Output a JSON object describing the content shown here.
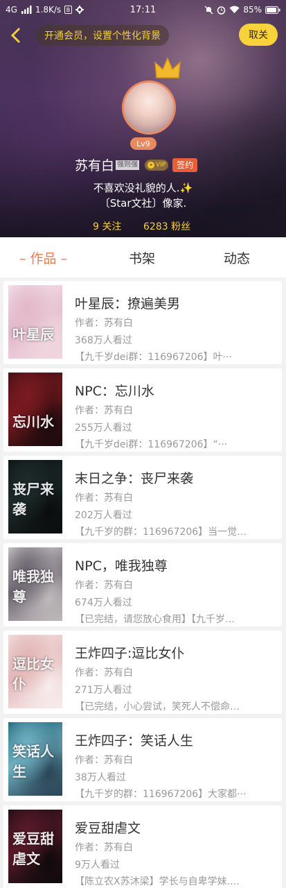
{
  "status_bar": {
    "network": "4G",
    "speed": "1.8K/s",
    "time": "17:11",
    "battery": "85%"
  },
  "header": {
    "banner_text": "开通会员，设置个性化背景",
    "cancel_label": "取关",
    "level": "Lv9",
    "username": "苏有白",
    "name_tag": "强则强",
    "vip_label": "VIP",
    "sign_label": "签约",
    "bio_line1": "不喜欢没礼貌的人.",
    "bio_sparkle": "✨",
    "bio_line2": "〔Star文社〕像家.",
    "follow_count": "9 关注",
    "fans_count": "6283 粉丝"
  },
  "tabs": {
    "works": "– 作品 –",
    "shelf": "书架",
    "feed": "动态"
  },
  "books": [
    {
      "title": "叶星辰：撩遍美男",
      "author": "作者：苏有白",
      "views": "368万人看过",
      "desc": "【九千岁dei群：116967206】叶···",
      "cover_text": "叶星辰",
      "cover_colors": [
        "#f6e7ee",
        "#e2b8c9",
        "#f0d6df"
      ]
    },
    {
      "title": "NPC：忘川水",
      "author": "作者：苏有白",
      "views": "255万人看过",
      "desc": "【九千岁dei群：116967206】“···",
      "cover_text": "忘川水",
      "cover_colors": [
        "#3a1013",
        "#7c1a20",
        "#1a0a0c"
      ]
    },
    {
      "title": "末日之争：丧尸来袭",
      "author": "作者：苏有白",
      "views": "202万人看过",
      "desc": "【九千岁的群：116967206】当一觉…",
      "cover_text": "丧尸来袭",
      "cover_colors": [
        "#0c1113",
        "#1e2b2a",
        "#0a0d0e"
      ]
    },
    {
      "title": "NPC，唯我独尊",
      "author": "作者：苏有白",
      "views": "674万人看过",
      "desc": "【已完结，请您放心食用】【九千岁…",
      "cover_text": "唯我独尊",
      "cover_colors": [
        "#d6d1d2",
        "#6b6570",
        "#bfb8ba"
      ]
    },
    {
      "title": "王炸四子:逗比女仆",
      "author": "作者：苏有白",
      "views": "271万人看过",
      "desc": "【已完结，小心尝试，笑死人不偿命…",
      "cover_text": "逗比女仆",
      "cover_colors": [
        "#f3e4e3",
        "#e3b5b6",
        "#f7ecec"
      ]
    },
    {
      "title": "王炸四子：笑话人生",
      "author": "作者：苏有白",
      "views": "38万人看过",
      "desc": "【九千岁的群：116967206】大家都···",
      "cover_text": "笑话人生",
      "cover_colors": [
        "#1f5f72",
        "#6fb0c2",
        "#2a4656"
      ]
    },
    {
      "title": "爱豆甜虐文",
      "author": "作者：苏有白",
      "views": "9万人看过",
      "desc": "【陈立农X苏沐梁】学长与自卑学妹.…",
      "cover_text": "爱豆甜虐文",
      "cover_colors": [
        "#1a0d12",
        "#5a1a2a",
        "#0f0a0c"
      ]
    }
  ]
}
